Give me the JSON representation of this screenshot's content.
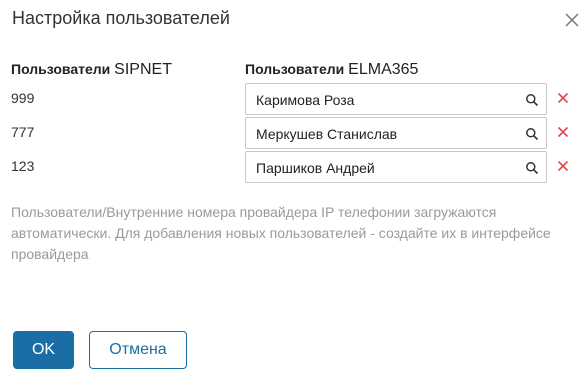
{
  "dialog": {
    "title": "Настройка пользователей",
    "close_icon": "close-icon"
  },
  "columns": {
    "left_prefix": "Пользователи",
    "left_brand": "SIPNET",
    "right_prefix": "Пользователи",
    "right_brand": "ELMA365"
  },
  "rows": [
    {
      "number": "999",
      "user": "Каримова Роза"
    },
    {
      "number": "777",
      "user": "Меркушев Станислав"
    },
    {
      "number": "123",
      "user": "Паршиков Андрей"
    }
  ],
  "hint": "Пользователи/Внутренние номера провайдера IP телефонии загружаются автоматически. Для добавления новых пользователей - создайте их в интерфейсе провайдера",
  "buttons": {
    "ok_label": "OK",
    "cancel_label": "Отмена"
  },
  "colors": {
    "primary": "#1b6ea5",
    "remove": "#e0474c",
    "hint": "#9a9a9a"
  },
  "icons": {
    "search": "search-icon",
    "remove": "remove-icon",
    "close": "close-icon"
  }
}
